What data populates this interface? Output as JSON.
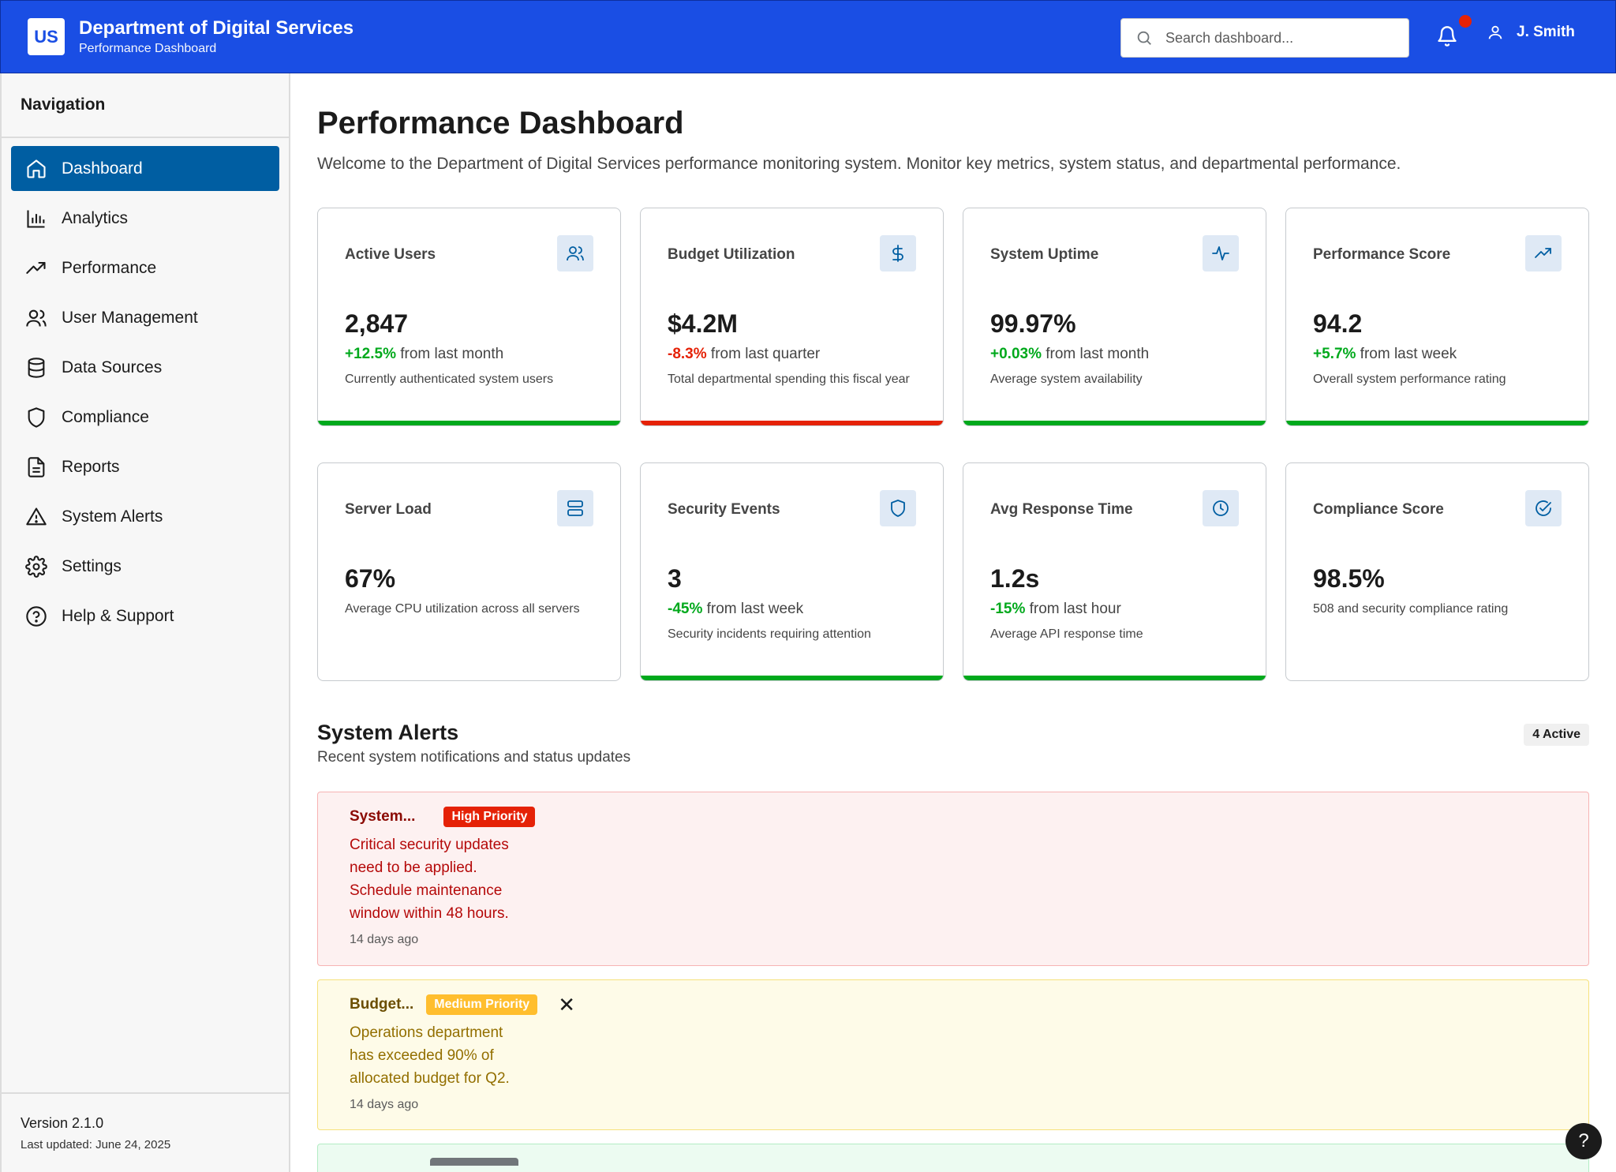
{
  "header": {
    "logo": "US",
    "title": "Department of Digital Services",
    "subtitle": "Performance Dashboard",
    "search_placeholder": "Search dashboard...",
    "user_name": "J. Smith",
    "notification_color": "#e52207"
  },
  "sidebar": {
    "title": "Navigation",
    "items": [
      {
        "label": "Dashboard",
        "icon": "home-icon",
        "active": true
      },
      {
        "label": "Analytics",
        "icon": "bar-chart-icon"
      },
      {
        "label": "Performance",
        "icon": "trending-up-icon"
      },
      {
        "label": "User Management",
        "icon": "users-icon"
      },
      {
        "label": "Data Sources",
        "icon": "database-icon"
      },
      {
        "label": "Compliance",
        "icon": "shield-icon"
      },
      {
        "label": "Reports",
        "icon": "file-text-icon"
      },
      {
        "label": "System Alerts",
        "icon": "alert-triangle-icon"
      },
      {
        "label": "Settings",
        "icon": "gear-icon"
      },
      {
        "label": "Help & Support",
        "icon": "help-circle-icon"
      }
    ],
    "version": "Version 2.1.0",
    "last_updated": "Last updated: June 24, 2025"
  },
  "main": {
    "title": "Performance Dashboard",
    "description": "Welcome to the Department of Digital Services performance monitoring system. Monitor key metrics, system status, and departmental performance."
  },
  "cards": [
    {
      "title": "Active Users",
      "icon": "users-icon",
      "value": "2,847",
      "change": "+12.5%",
      "change_text": " from last month",
      "trend": "positive",
      "description": "Currently authenticated system users",
      "bar": "green"
    },
    {
      "title": "Budget Utilization",
      "icon": "dollar-icon",
      "value": "$4.2M",
      "change": "-8.3%",
      "change_text": " from last quarter",
      "trend": "negative",
      "description": "Total departmental spending this fiscal year",
      "bar": "red"
    },
    {
      "title": "System Uptime",
      "icon": "activity-icon",
      "value": "99.97%",
      "change": "+0.03%",
      "change_text": " from last month",
      "trend": "positive",
      "description": "Average system availability",
      "bar": "green"
    },
    {
      "title": "Performance Score",
      "icon": "trending-up-icon",
      "value": "94.2",
      "change": "+5.7%",
      "change_text": " from last week",
      "trend": "positive",
      "description": "Overall system performance rating",
      "bar": "green"
    },
    {
      "title": "Server Load",
      "icon": "server-icon",
      "value": "67%",
      "description": "Average CPU utilization across all servers",
      "bar": "none"
    },
    {
      "title": "Security Events",
      "icon": "shield-icon",
      "value": "3",
      "change": "-45%",
      "change_text": " from last week",
      "trend": "positive",
      "description": "Security incidents requiring attention",
      "bar": "green"
    },
    {
      "title": "Avg Response Time",
      "icon": "clock-icon",
      "value": "1.2s",
      "change": "-15%",
      "change_text": " from last hour",
      "trend": "positive",
      "description": "Average API response time",
      "bar": "green"
    },
    {
      "title": "Compliance Score",
      "icon": "check-circle-icon",
      "value": "98.5%",
      "description": "508 and security compliance rating",
      "bar": "none"
    }
  ],
  "alerts": {
    "title": "System Alerts",
    "subtitle": "Recent system notifications and status updates",
    "active_count": "4 Active",
    "items": [
      {
        "name": "System...",
        "priority": "High Priority",
        "message": "Critical security updates need to be applied. Schedule maintenance window within 48 hours.",
        "time": "14 days ago",
        "level": "high"
      },
      {
        "name": "Budget...",
        "priority": "Medium Priority",
        "message": "Operations department has exceeded 90% of allocated budget for Q2.",
        "time": "14 days ago",
        "level": "medium",
        "dismiss": "✕"
      }
    ]
  },
  "help_fab": "?"
}
